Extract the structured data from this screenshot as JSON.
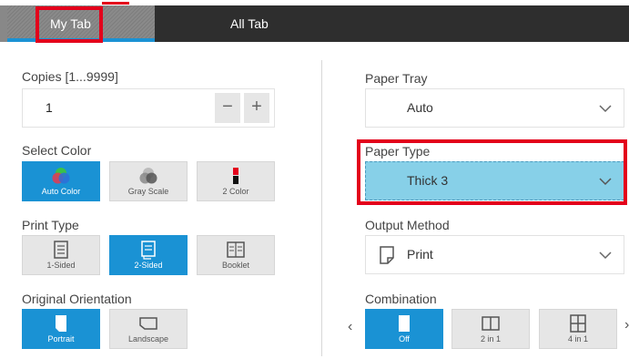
{
  "tabs": {
    "my_tab": "My Tab",
    "all_tab": "All Tab"
  },
  "copies": {
    "label": "Copies [1...9999]",
    "value": "1",
    "minus": "−",
    "plus": "+"
  },
  "select_color": {
    "label": "Select Color",
    "options": [
      "Auto Color",
      "Gray Scale",
      "2 Color"
    ],
    "selected": "Auto Color"
  },
  "print_type": {
    "label": "Print Type",
    "options": [
      "1-Sided",
      "2-Sided",
      "Booklet"
    ],
    "selected": "2-Sided"
  },
  "original_orientation": {
    "label": "Original Orientation",
    "options": [
      "Portrait",
      "Landscape"
    ],
    "selected": "Portrait"
  },
  "paper_tray": {
    "label": "Paper Tray",
    "value": "Auto"
  },
  "paper_type": {
    "label": "Paper Type",
    "value": "Thick 3"
  },
  "output_method": {
    "label": "Output Method",
    "value": "Print"
  },
  "combination": {
    "label": "Combination",
    "options": [
      "Off",
      "2 in 1",
      "4 in 1"
    ],
    "selected": "Off",
    "prev": "‹",
    "next": "›"
  },
  "colors": {
    "accent": "#1a92d4",
    "highlight": "#e3001b",
    "selected_dropdown": "#87d0e8",
    "tabbar": "#2e2e2e"
  }
}
